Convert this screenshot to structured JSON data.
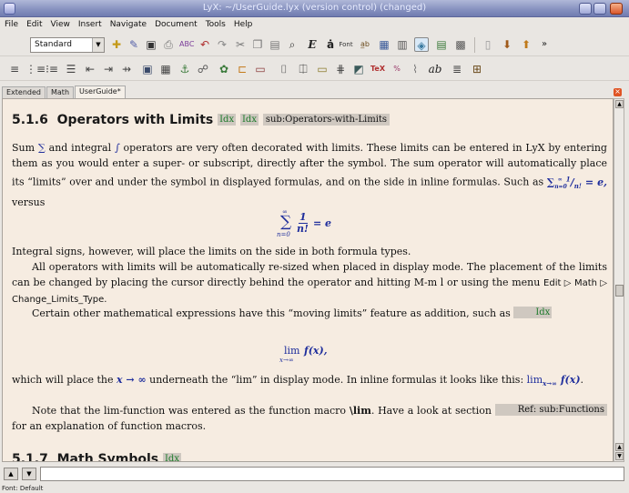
{
  "window": {
    "title": "LyX: ~/UserGuide.lyx (version control) (changed)"
  },
  "menu": [
    "File",
    "Edit",
    "View",
    "Insert",
    "Navigate",
    "Document",
    "Tools",
    "Help"
  ],
  "toolbar": {
    "layout_value": "Standard",
    "font_button": "Font"
  },
  "tabs": [
    "Extended",
    "Math",
    "UserGuide*"
  ],
  "doc": {
    "section_num": "5.1.6",
    "section_title": "Operators with Limits",
    "idx": "Idx",
    "label": "sub:Operators-with-Limits",
    "p1_a": "Sum",
    "p1_b": "and integral",
    "p1_c": "operators are very often decorated with limits. These limits can be entered in LyX by entering them as you would enter a super- or subscript, directly after the symbol. The sum operator will automatically place its “limits” over and under the symbol in displayed formulas, and on the side in inline formulas. Such as",
    "p1_d": "versus",
    "p2": "Integral signs, however, will place the limits on the side in both formula types.",
    "p3": "All operators with limits will be automatically re-sized when placed in display mode. The placement of the limits can be changed by placing the cursor directly behind the operator and hitting M-m l or using the menu",
    "p3_menu": "Edit ▷ Math ▷ Change_Limits_Type.",
    "p4": "Certain other mathematical expressions have this “moving limits” feature as addition, such as",
    "p5_a": "which will place the",
    "p5_b": "underneath the “lim” in display mode. In inline formulas it looks like this:",
    "p6_a": "Note that the lim-function was entered as the function macro",
    "p6_bold": "\\lim",
    "p6_b": ". Have a look at section",
    "ref": "Ref: sub:Functions",
    "p6_c": "for an explanation of function macros.",
    "next_num": "5.1.7",
    "next_title": "Math Symbols"
  },
  "status": "Font: Default",
  "colors": {
    "math": "#1f2e9c",
    "inset_text": "#1d7a2a",
    "page_bg": "#f6ece1"
  }
}
